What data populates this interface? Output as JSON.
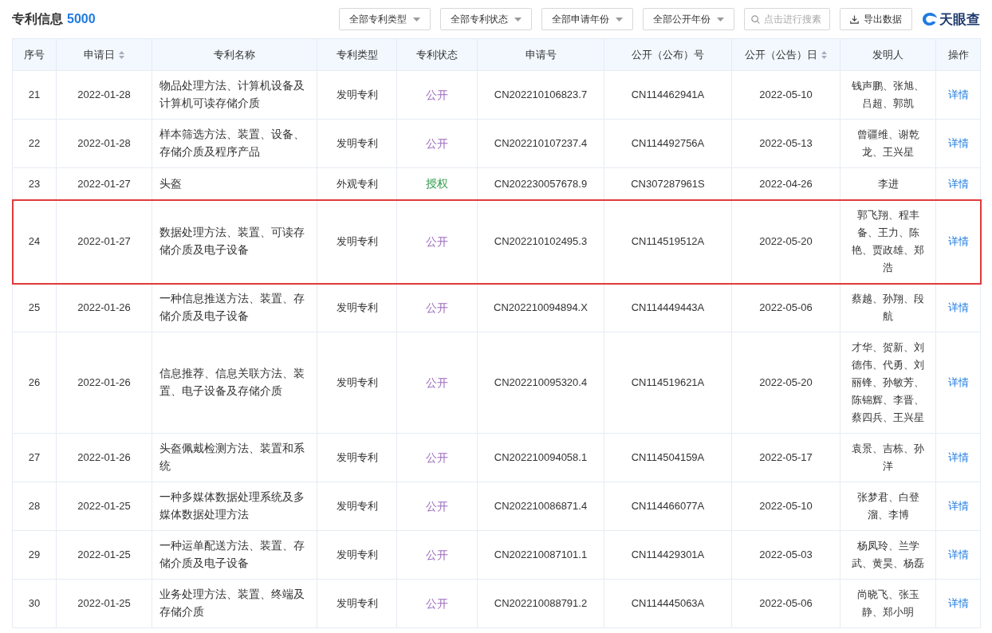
{
  "header": {
    "title": "专利信息",
    "count": "5000",
    "filters": [
      "全部专利类型",
      "全部专利状态",
      "全部申请年份",
      "全部公开年份"
    ],
    "search": {
      "placeholder": "点击进行搜素"
    },
    "export_button": "导出数据",
    "logo": "天眼查"
  },
  "table": {
    "columns": [
      {
        "label": "序号",
        "sortable": false
      },
      {
        "label": "申请日",
        "sortable": true
      },
      {
        "label": "专利名称",
        "sortable": false
      },
      {
        "label": "专利类型",
        "sortable": false
      },
      {
        "label": "专利状态",
        "sortable": false
      },
      {
        "label": "申请号",
        "sortable": false
      },
      {
        "label": "公开（公布）号",
        "sortable": false
      },
      {
        "label": "公开（公告）日",
        "sortable": true
      },
      {
        "label": "发明人",
        "sortable": false
      },
      {
        "label": "操作",
        "sortable": false
      }
    ],
    "rows": [
      {
        "no": "21",
        "date": "2022-01-28",
        "name": "物品处理方法、计算机设备及计算机可读存储介质",
        "type": "发明专利",
        "status": {
          "text": "公开",
          "color": "#9b6bbf"
        },
        "app_no": "CN202210106823.7",
        "pub_no": "CN114462941A",
        "pub_date": "2022-05-10",
        "inventors": "钱声鹏、张旭、吕超、郭凯",
        "action": "详情",
        "highlighted": false
      },
      {
        "no": "22",
        "date": "2022-01-28",
        "name": "样本筛选方法、装置、设备、存储介质及程序产品",
        "type": "发明专利",
        "status": {
          "text": "公开",
          "color": "#9b6bbf"
        },
        "app_no": "CN202210107237.4",
        "pub_no": "CN114492756A",
        "pub_date": "2022-05-13",
        "inventors": "曾疆维、谢乾龙、王兴星",
        "action": "详情",
        "highlighted": false
      },
      {
        "no": "23",
        "date": "2022-01-27",
        "name": "头盔",
        "type": "外观专利",
        "status": {
          "text": "授权",
          "color": "#2e9a4a"
        },
        "app_no": "CN202230057678.9",
        "pub_no": "CN307287961S",
        "pub_date": "2022-04-26",
        "inventors": "李进",
        "action": "详情",
        "highlighted": false
      },
      {
        "no": "24",
        "date": "2022-01-27",
        "name": "数据处理方法、装置、可读存储介质及电子设备",
        "type": "发明专利",
        "status": {
          "text": "公开",
          "color": "#9b6bbf"
        },
        "app_no": "CN202210102495.3",
        "pub_no": "CN114519512A",
        "pub_date": "2022-05-20",
        "inventors": "郭飞翔、程丰备、王力、陈艳、贾政雄、郑浩",
        "action": "详情",
        "highlighted": true
      },
      {
        "no": "25",
        "date": "2022-01-26",
        "name": "一种信息推送方法、装置、存储介质及电子设备",
        "type": "发明专利",
        "status": {
          "text": "公开",
          "color": "#9b6bbf"
        },
        "app_no": "CN202210094894.X",
        "pub_no": "CN114449443A",
        "pub_date": "2022-05-06",
        "inventors": "蔡越、孙翔、段航",
        "action": "详情",
        "highlighted": false
      },
      {
        "no": "26",
        "date": "2022-01-26",
        "name": "信息推荐、信息关联方法、装置、电子设备及存储介质",
        "type": "发明专利",
        "status": {
          "text": "公开",
          "color": "#9b6bbf"
        },
        "app_no": "CN202210095320.4",
        "pub_no": "CN114519621A",
        "pub_date": "2022-05-20",
        "inventors": "才华、贺新、刘德伟、代勇、刘丽锋、孙敏芳、陈锦辉、李晋、蔡四兵、王兴星",
        "action": "详情",
        "highlighted": false
      },
      {
        "no": "27",
        "date": "2022-01-26",
        "name": "头盔佩戴检测方法、装置和系统",
        "type": "发明专利",
        "status": {
          "text": "公开",
          "color": "#9b6bbf"
        },
        "app_no": "CN202210094058.1",
        "pub_no": "CN114504159A",
        "pub_date": "2022-05-17",
        "inventors": "袁景、吉栋、孙洋",
        "action": "详情",
        "highlighted": false
      },
      {
        "no": "28",
        "date": "2022-01-25",
        "name": "一种多媒体数据处理系统及多媒体数据处理方法",
        "type": "发明专利",
        "status": {
          "text": "公开",
          "color": "#9b6bbf"
        },
        "app_no": "CN202210086871.4",
        "pub_no": "CN114466077A",
        "pub_date": "2022-05-10",
        "inventors": "张梦君、白登溜、李博",
        "action": "详情",
        "highlighted": false
      },
      {
        "no": "29",
        "date": "2022-01-25",
        "name": "一种运单配送方法、装置、存储介质及电子设备",
        "type": "发明专利",
        "status": {
          "text": "公开",
          "color": "#9b6bbf"
        },
        "app_no": "CN202210087101.1",
        "pub_no": "CN114429301A",
        "pub_date": "2022-05-03",
        "inventors": "杨凤玲、兰学武、黄昊、杨磊",
        "action": "详情",
        "highlighted": false
      },
      {
        "no": "30",
        "date": "2022-01-25",
        "name": "业务处理方法、装置、终端及存储介质",
        "type": "发明专利",
        "status": {
          "text": "公开",
          "color": "#9b6bbf"
        },
        "app_no": "CN202210088791.2",
        "pub_no": "CN114445063A",
        "pub_date": "2022-05-06",
        "inventors": "尚晓飞、张玉静、郑小明",
        "action": "详情",
        "highlighted": false
      }
    ]
  }
}
